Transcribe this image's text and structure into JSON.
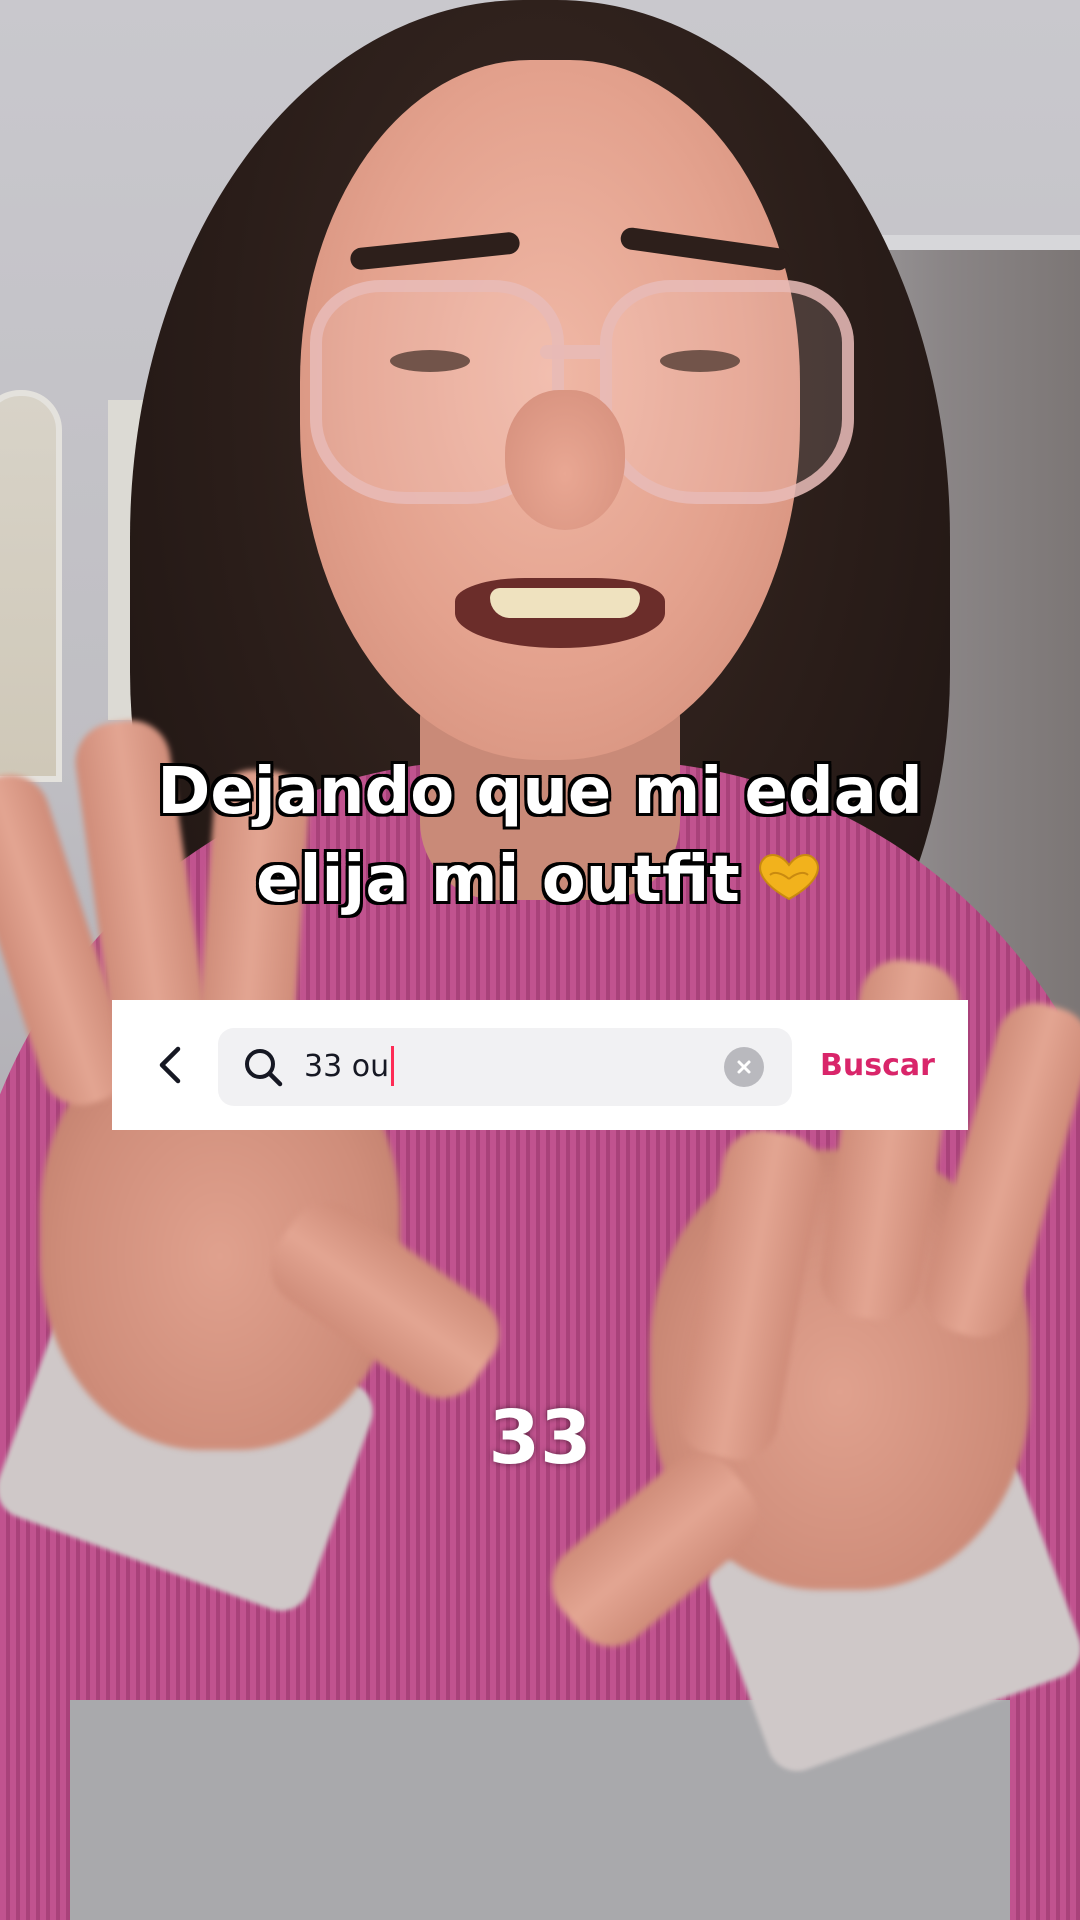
{
  "caption": {
    "line1": "Dejando que mi edad",
    "line2": "elija mi outfit",
    "emoji": "heart-hands-icon"
  },
  "search": {
    "back_icon": "chevron-left-icon",
    "search_icon": "search-icon",
    "value": "33 ou",
    "clear_icon": "clear-icon",
    "submit_label": "Buscar"
  },
  "counter": "33",
  "colors": {
    "accent": "#fe2c55",
    "buscar_text": "#d9256a",
    "sweater": "#c1538f",
    "search_field_bg": "#f1f1f3"
  }
}
